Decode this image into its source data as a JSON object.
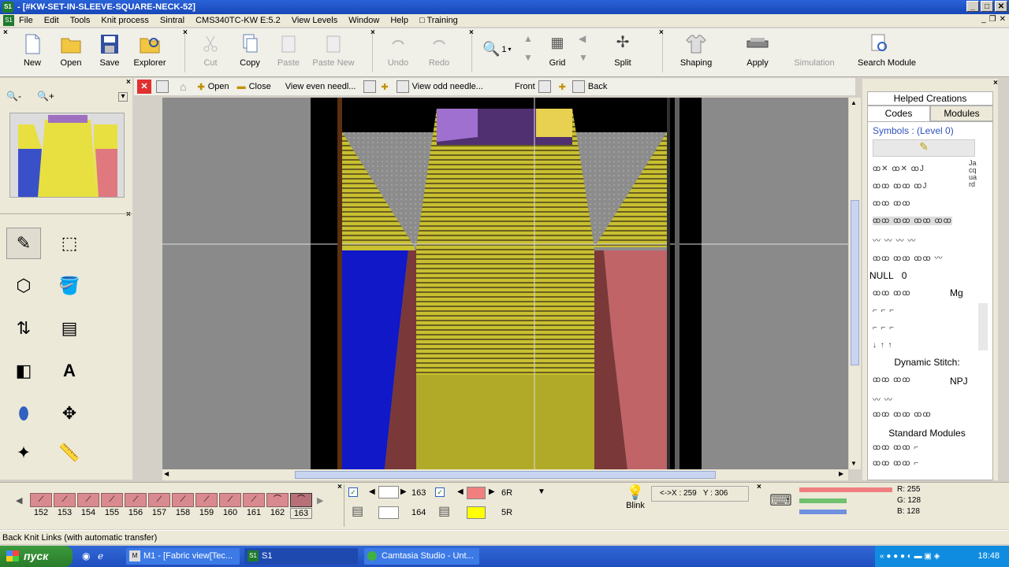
{
  "window": {
    "title": "- [#KW-SET-IN-SLEEVE-SQUARE-NECK-52]",
    "app_badge": "S1"
  },
  "menu": [
    "File",
    "Edit",
    "Tools",
    "Knit process",
    "Sintral",
    "CMS340TC-KW E:5.2",
    "View Levels",
    "Window",
    "Help",
    "Training"
  ],
  "toolbar": {
    "new": "New",
    "open": "Open",
    "save": "Save",
    "explorer": "Explorer",
    "cut": "Cut",
    "copy": "Copy",
    "paste": "Paste",
    "paste_new": "Paste New",
    "undo": "Undo",
    "redo": "Redo",
    "zoom_level": "1",
    "grid": "Grid",
    "split": "Split",
    "shaping": "Shaping",
    "apply": "Apply",
    "simulation": "Simulation",
    "search_module": "Search Module"
  },
  "viewbar": {
    "open": "Open",
    "close": "Close",
    "view_even": "View even needl...",
    "view_odd": "View odd needle...",
    "front": "Front",
    "back": "Back"
  },
  "right_panel": {
    "header": "Helped Creations",
    "tabs": [
      "Codes",
      "Modules"
    ],
    "symbols_title": "Symbols : (Level 0)",
    "jacquard": "Jacquard",
    "null_label": "NULL",
    "null_value": "0",
    "mg": "Mg",
    "dynamic_stitch": "Dynamic Stitch:",
    "npj": "NPJ",
    "standard_modules": "Standard Modules"
  },
  "needles": [
    "152",
    "153",
    "154",
    "155",
    "156",
    "157",
    "158",
    "159",
    "160",
    "161",
    "162",
    "163"
  ],
  "rows": {
    "r1": "163",
    "r2": "164",
    "c1_label": "6R",
    "c2_label": "5R",
    "c1_color": "#f08080",
    "c2_color": "#ffff00"
  },
  "blink": "Blink",
  "coords": "<->X : 259   Y : 306",
  "rgb": {
    "r": "R: 255",
    "g": "G: 128",
    "b": "B: 128"
  },
  "status": "Back Knit Links (with automatic transfer)",
  "taskbar": {
    "start": "пуск",
    "tasks": [
      "M1 - [Fabric view[Tec...",
      "S1",
      "Camtasia Studio - Unt..."
    ],
    "clock": "18:48"
  }
}
